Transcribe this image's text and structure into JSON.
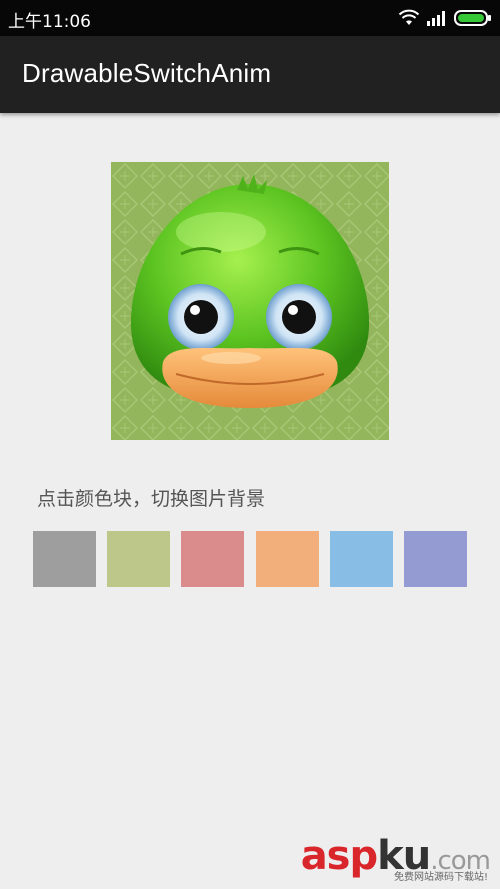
{
  "status_bar": {
    "time": "上午11:06",
    "icons": [
      "wifi-icon",
      "signal-icon",
      "battery-icon"
    ]
  },
  "app_bar": {
    "title": "DrawableSwitchAnim"
  },
  "main": {
    "image": "duck-image",
    "hint": "点击颜色块，切换图片背景",
    "swatches": [
      {
        "name": "gray",
        "color": "#9e9e9e"
      },
      {
        "name": "olive",
        "color": "#bcc789"
      },
      {
        "name": "pink",
        "color": "#da8b8b"
      },
      {
        "name": "orange",
        "color": "#f2ae7b"
      },
      {
        "name": "light-blue",
        "color": "#88bde6"
      },
      {
        "name": "purple",
        "color": "#939bd2"
      }
    ]
  },
  "watermark": {
    "asp": "asp",
    "ku": "ku",
    "dotcom": ".com",
    "sub": "免费网站源码下载站!"
  }
}
